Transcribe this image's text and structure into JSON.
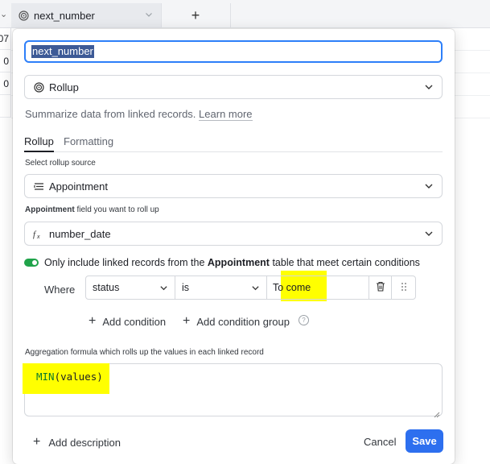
{
  "background": {
    "column_title": "next_number",
    "column_icon": "rollup-icon",
    "add_column_label": "+",
    "row_values": [
      "07",
      "0",
      "0"
    ]
  },
  "dialog": {
    "field_name": "next_number",
    "field_type": {
      "icon": "rollup-icon",
      "label": "Rollup"
    },
    "description": "Summarize data from linked records.",
    "learn_more": "Learn more",
    "tabs": [
      {
        "label": "Rollup",
        "active": true
      },
      {
        "label": "Formatting",
        "active": false
      }
    ],
    "rollup_source_label": "Select rollup source",
    "rollup_source": {
      "icon": "link-list-icon",
      "label": "Appointment"
    },
    "field_label_prefix": "Appointment",
    "field_label_suffix": "field you want to roll up",
    "rollup_field": {
      "icon": "formula-icon",
      "label": "number_date"
    },
    "conditions_toggle": {
      "on": true,
      "text_prefix": "Only include linked records from the",
      "table_name": "Appointment",
      "text_suffix": "table that meet certain conditions"
    },
    "condition": {
      "where_label": "Where",
      "field": "status",
      "operator": "is",
      "value": "To come"
    },
    "add_condition_label": "Add condition",
    "add_condition_group_label": "Add condition group",
    "aggregation_label": "Aggregation formula which rolls up the values in each linked record",
    "formula": {
      "function": "MIN",
      "args": "(values)"
    },
    "footer": {
      "add_description": "Add description",
      "cancel": "Cancel",
      "save": "Save"
    }
  },
  "colors": {
    "accent": "#2d6fef",
    "toggle_on": "#20a34a",
    "highlight": "#ffff00",
    "formula_function": "#0a7a2c"
  }
}
